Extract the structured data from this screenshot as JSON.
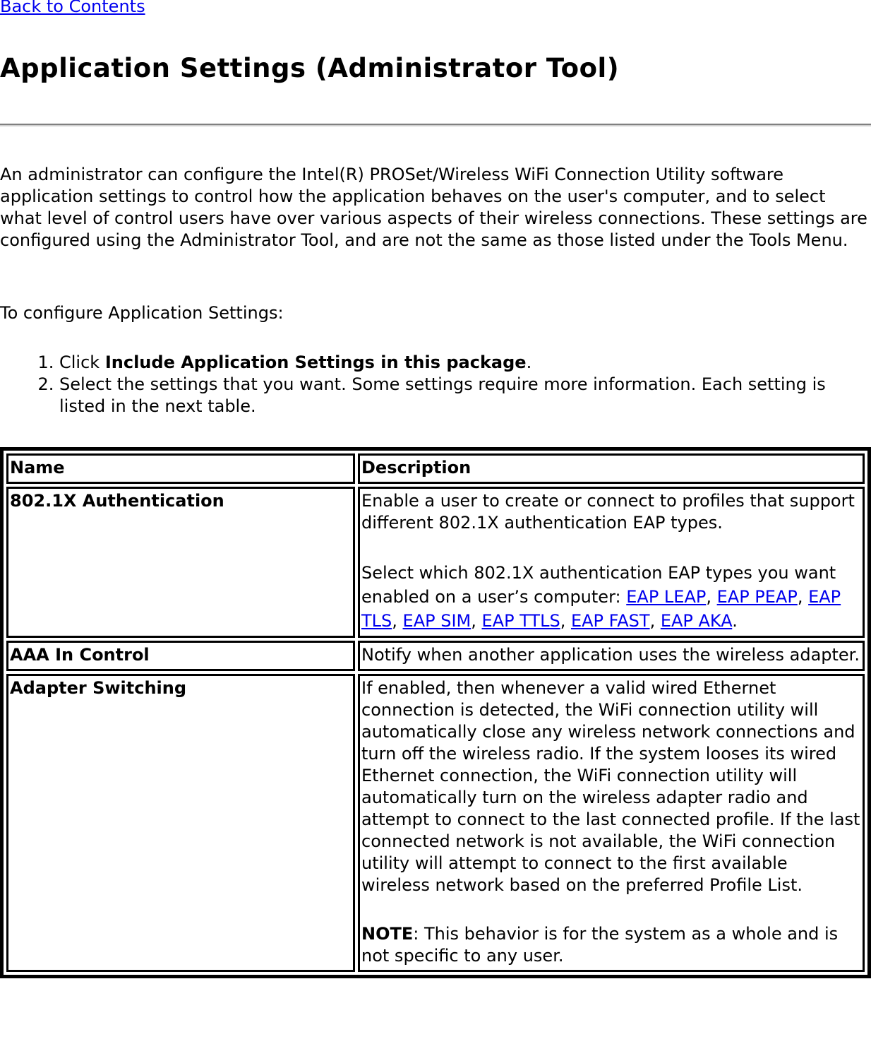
{
  "nav": {
    "back_link": "Back to Contents"
  },
  "page": {
    "title": "Application Settings (Administrator Tool)",
    "intro": "An administrator can configure the Intel(R) PROSet/Wireless WiFi Connection Utility software application settings to control how the application behaves on the user's computer, and to select what level of control users have over various aspects of their wireless connections. These settings are configured using the Administrator Tool, and are not the same as those listed under the Tools Menu.",
    "lead": "To configure Application Settings:",
    "steps": [
      {
        "prefix": "Click ",
        "bold": "Include Application Settings in this package",
        "suffix": "."
      },
      {
        "text": "Select the settings that you want. Some settings require more information. Each setting is listed in the next table."
      }
    ]
  },
  "table": {
    "headers": {
      "name": "Name",
      "description": "Description"
    },
    "rows": [
      {
        "name": "802.1X Authentication",
        "desc1": "Enable a user to create or connect to profiles that support different 802.1X authentication EAP types.",
        "desc2_prefix": "Select which 802.1X authentication EAP types you want enabled on a user’s computer: ",
        "eap_links": [
          "EAP LEAP",
          "EAP PEAP",
          "EAP TLS",
          "EAP SIM",
          "EAP TTLS",
          "EAP FAST",
          "EAP AKA"
        ]
      },
      {
        "name": "AAA In Control",
        "desc1": "Notify when another application uses the wireless adapter."
      },
      {
        "name": "Adapter Switching",
        "desc1": "If enabled, then whenever a valid wired Ethernet connection is detected, the WiFi connection utility will automatically close any wireless network connections and turn off the wireless radio. If the system looses its wired Ethernet connection, the WiFi connection utility will automatically turn on the wireless adapter radio and attempt to connect to the last connected profile. If the last connected network is not available, the WiFi connection utility will attempt to connect to the first available wireless network based on the preferred Profile List.",
        "note_label": "NOTE",
        "note_text": ": This behavior is for the system as a whole and is not specific to any user."
      }
    ]
  }
}
